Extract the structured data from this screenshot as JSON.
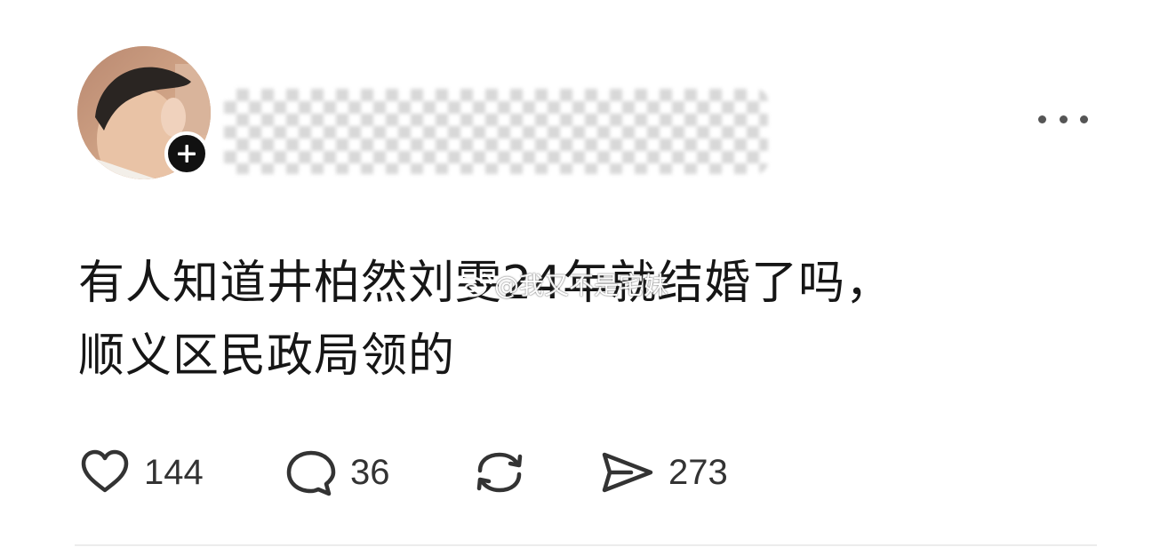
{
  "post": {
    "text_line1": "有人知道井柏然刘雯24年就结婚了吗，",
    "text_line2": "顺义区民政局领的",
    "watermark": "@我又不是宅妹",
    "actions": {
      "like_count": "144",
      "comment_count": "36",
      "share_count": "273"
    }
  },
  "icons": {
    "follow": "plus-icon",
    "more": "more-dots-icon",
    "like": "heart-outline-icon",
    "comment": "speech-bubble-icon",
    "repost": "repost-arrows-icon",
    "share": "send-icon"
  },
  "colors": {
    "text": "#161616",
    "icon": "#333333",
    "badge": "#111111"
  }
}
